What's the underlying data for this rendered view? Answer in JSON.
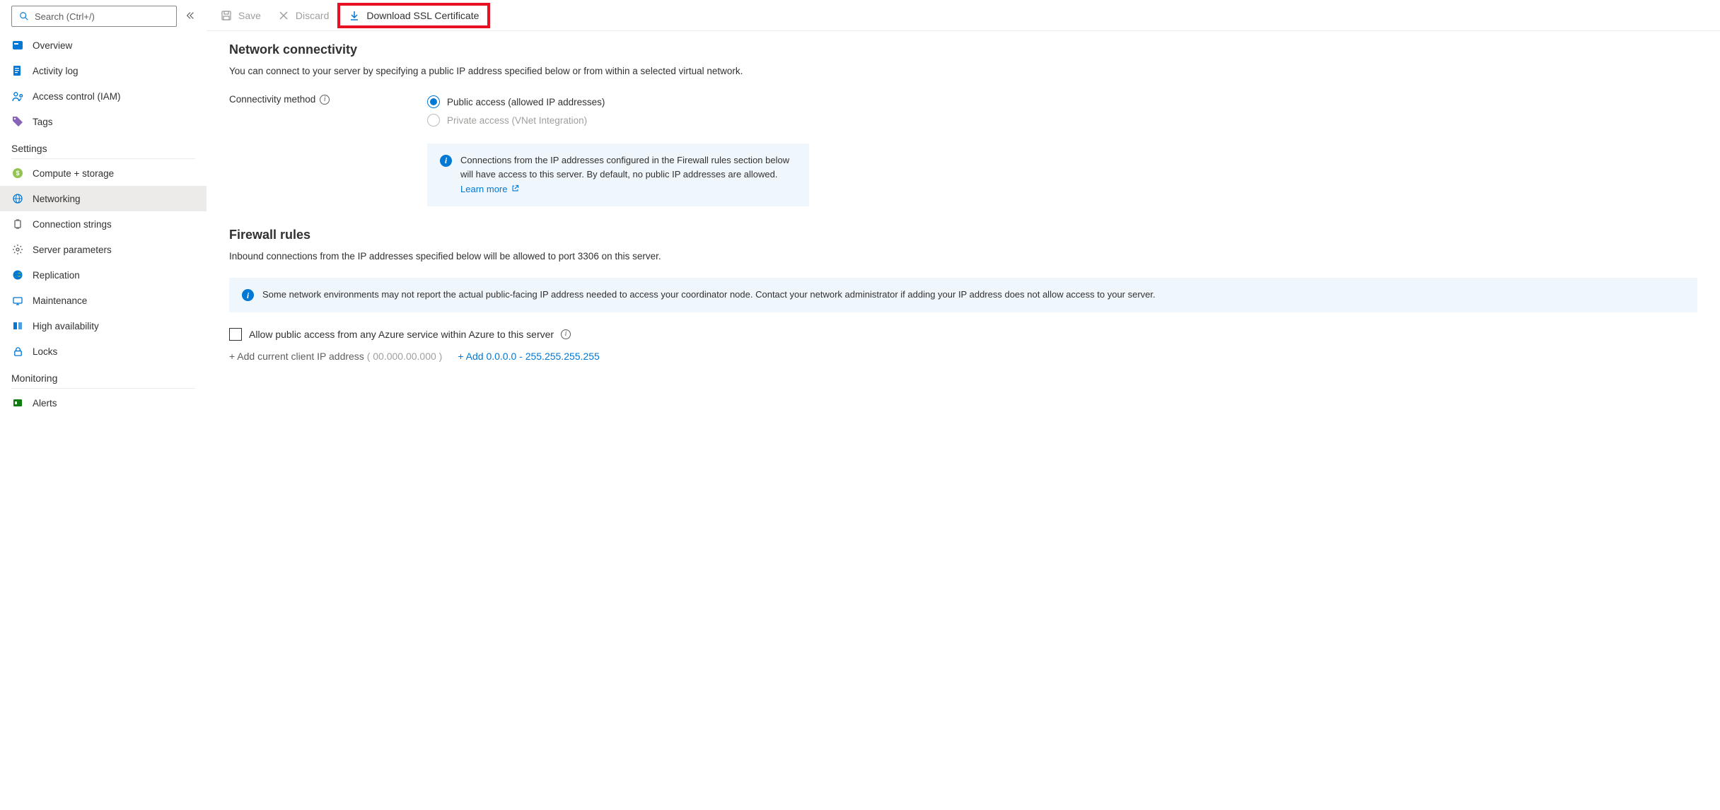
{
  "sidebar": {
    "search_placeholder": "Search (Ctrl+/)",
    "items_top": [
      {
        "label": "Overview"
      },
      {
        "label": "Activity log"
      },
      {
        "label": "Access control (IAM)"
      },
      {
        "label": "Tags"
      }
    ],
    "group_settings": "Settings",
    "items_settings": [
      {
        "label": "Compute + storage"
      },
      {
        "label": "Networking",
        "active": true
      },
      {
        "label": "Connection strings"
      },
      {
        "label": "Server parameters"
      },
      {
        "label": "Replication"
      },
      {
        "label": "Maintenance"
      },
      {
        "label": "High availability"
      },
      {
        "label": "Locks"
      }
    ],
    "group_monitoring": "Monitoring",
    "items_monitoring": [
      {
        "label": "Alerts"
      }
    ]
  },
  "toolbar": {
    "save": "Save",
    "discard": "Discard",
    "download_ssl": "Download SSL Certificate"
  },
  "network": {
    "title": "Network connectivity",
    "desc": "You can connect to your server by specifying a public IP address specified below or from within a selected virtual network.",
    "method_label": "Connectivity method",
    "option_public": "Public access (allowed IP addresses)",
    "option_private": "Private access (VNet Integration)",
    "info1_text": "Connections from the IP addresses configured in the Firewall rules section below will have access to this server. By default, no public IP addresses are allowed. ",
    "learn_more": "Learn more"
  },
  "firewall": {
    "title": "Firewall rules",
    "desc": "Inbound connections from the IP addresses specified below will be allowed to port 3306 on this server.",
    "info2_text": "Some network environments may not report the actual public-facing IP address needed to access your coordinator node. Contact your network administrator if adding your IP address does not allow access to your server.",
    "allow_azure_label": "Allow public access from any Azure service within Azure to this server",
    "add_client_label": "Add current client IP address",
    "client_ip_placeholder": "( 00.000.00.000 )",
    "add_any_label": "Add 0.0.0.0 - 255.255.255.255"
  }
}
